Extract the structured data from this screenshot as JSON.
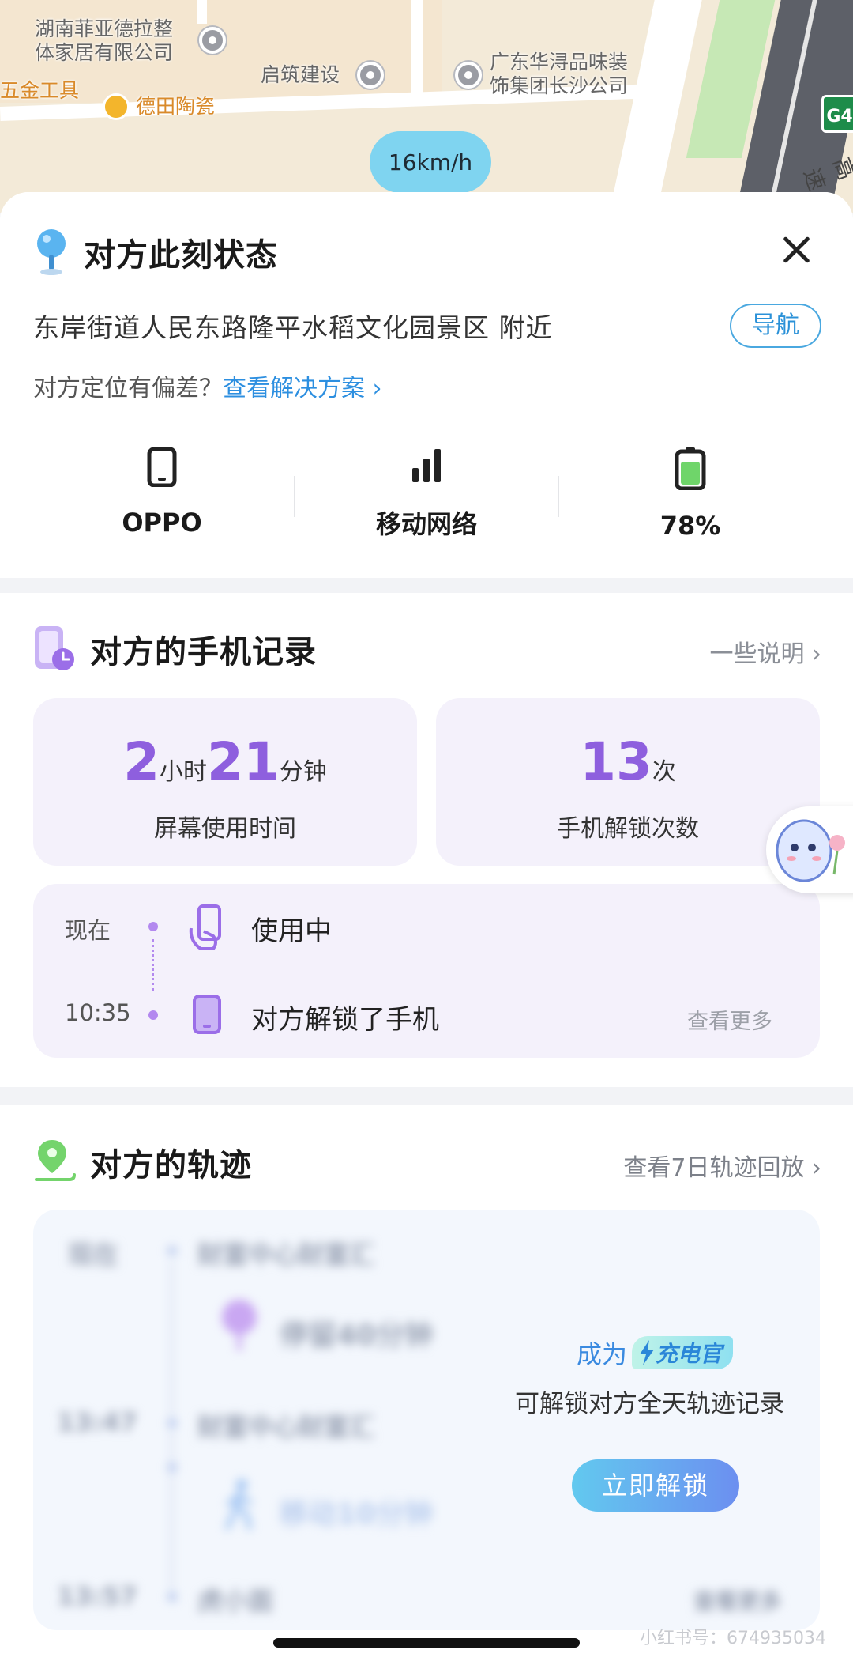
{
  "map": {
    "labels": [
      "湖南菲亚德拉整",
      "体家居有限公司",
      "启筑建设",
      "广东华浔品味装",
      "饰集团长沙公司",
      "五金工具",
      "德田陶瓷"
    ],
    "speed": "16km/h",
    "highway_badge": "G4",
    "highway_text": "高速"
  },
  "status": {
    "title": "对方此刻状态",
    "address": "东岸街道人民东路隆平水稻文化园景区 附近",
    "nav_label": "导航",
    "deviation_question": "对方定位有偏差？",
    "deviation_link": "查看解决方案",
    "device": {
      "name": "OPPO",
      "icon": "phone-icon"
    },
    "network": {
      "name": "移动网络",
      "icon": "signal-bars-icon"
    },
    "battery": {
      "percent": "78%",
      "level": 0.78,
      "icon": "battery-icon",
      "color": "#6fd56a"
    }
  },
  "record": {
    "title": "对方的手机记录",
    "side_link": "一些说明",
    "screen_time": {
      "hours": "2",
      "hours_unit": "小时",
      "minutes": "21",
      "minutes_unit": "分钟",
      "label": "屏幕使用时间"
    },
    "unlocks": {
      "count": "13",
      "unit": "次",
      "label": "手机解锁次数"
    },
    "timeline": [
      {
        "time": "现在",
        "text": "使用中",
        "icon": "hand-phone-icon"
      },
      {
        "time": "10:35",
        "text": "对方解锁了手机",
        "icon": "phone-icon"
      }
    ],
    "more": "查看更多",
    "accent": "#8e5fde"
  },
  "track": {
    "title": "对方的轨迹",
    "side_link": "查看7日轨迹回放",
    "blurred": {
      "rows": [
        "现在",
        "财富中心财富汇",
        "停留40分钟",
        "13:47",
        "财富中心财富汇",
        "移动10分钟",
        "13:57",
        "虎小面"
      ],
      "more": "查看更多"
    },
    "unlock": {
      "prefix": "成为",
      "tag": "充电官",
      "description": "可解锁对方全天轨迹记录",
      "button": "立即解锁"
    }
  },
  "watermark": "小红书号：674935034"
}
